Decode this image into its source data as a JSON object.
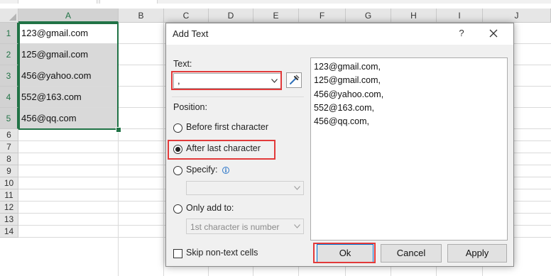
{
  "spreadsheet": {
    "columns": [
      "A",
      "B",
      "C",
      "D",
      "E",
      "F",
      "G",
      "H",
      "I",
      "J"
    ],
    "rows": [
      "1",
      "2",
      "3",
      "4",
      "5",
      "6",
      "7",
      "8",
      "9",
      "10",
      "11",
      "12",
      "13",
      "14"
    ],
    "cells_a": [
      "123@gmail.com",
      "125@gmail.com",
      "456@yahoo.com",
      "552@163.com",
      "456@qq.com"
    ]
  },
  "dialog": {
    "title": "Add Text",
    "help_label": "?",
    "text_label": "Text:",
    "text_value": ",",
    "position_label": "Position:",
    "options": {
      "before": "Before first character",
      "after": "After last character",
      "specify": "Specify:",
      "only_add": "Only add to:"
    },
    "selected_option": "After last character",
    "only_add_value": "1st character is number",
    "preview_lines": [
      "123@gmail.com,",
      "125@gmail.com,",
      "456@yahoo.com,",
      "552@163.com,",
      "456@qq.com,"
    ],
    "skip_label": "Skip non-text cells",
    "skip_checked": false,
    "buttons": {
      "ok": "Ok",
      "cancel": "Cancel",
      "apply": "Apply"
    }
  },
  "colors": {
    "highlight_box": "#e23a3a",
    "selection_border": "#217346",
    "selected_cell_fill": "#d9d9d9",
    "default_button_border": "#0078d7"
  }
}
